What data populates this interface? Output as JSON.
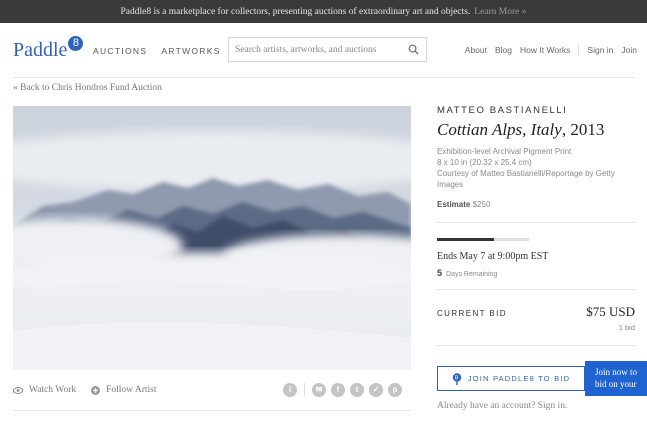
{
  "topbar": {
    "message": "Paddle8 is a marketplace for collectors, presenting auctions of extraordinary art and objects.",
    "learn_more": "Learn More »"
  },
  "header": {
    "logo_text": "Paddle",
    "logo_badge": "8",
    "nav": [
      "AUCTIONS",
      "ARTWORKS"
    ],
    "search_placeholder": "Search artists, artworks, and auctions",
    "right_links": [
      "About",
      "Blog",
      "How It Works"
    ],
    "sign_in": "Sign in",
    "join": "Join"
  },
  "back_link": "« Back to Chris Hondros Fund Auction",
  "artwork": {
    "actions": {
      "watch": "Watch Work",
      "follow": "Follow Artist"
    },
    "share_icons": [
      "info-icon",
      "email-icon",
      "facebook-icon",
      "tumblr-icon",
      "twitter-icon",
      "pinterest-icon"
    ]
  },
  "lot": {
    "artist": "MATTEO BASTIANELLI",
    "title": "Cottian Alps, Italy",
    "year": ", 2013",
    "medium": "Exhibition-level Archival Pigment Print",
    "dimensions": "8 x 10 in (20.32 x 25.4 cm)",
    "courtesy": "Courtesy of Matteo Bastianelli/Reportage by Getty Images",
    "estimate_label": "Estimate",
    "estimate_value": "$250",
    "time_progress": 0.62,
    "ends": "Ends May 7 at 9:00pm EST",
    "days_number": "5",
    "days_label": "Days Remaining",
    "current_bid_label": "CURRENT BID",
    "current_bid": "$75 USD",
    "bid_count": "1 bid",
    "join_button": "JOIN PADDLE8 TO BID",
    "account_prompt": "Already have an account? Sign in."
  },
  "tooltip": {
    "line1": "Join now to",
    "line2": "bid on your"
  },
  "colors": {
    "brand": "#2e63b8",
    "tooltip": "#1f63d0",
    "topbar": "#3a3a3a"
  }
}
